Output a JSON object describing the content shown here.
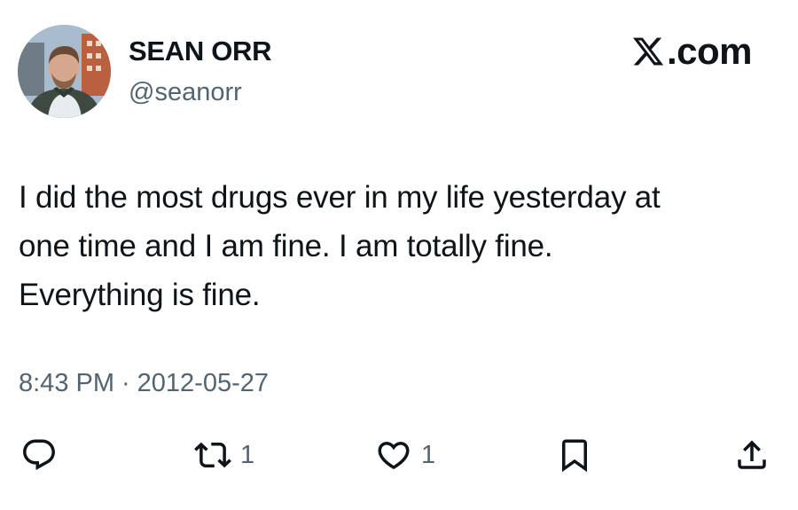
{
  "user": {
    "display_name": "SEAN ORR",
    "handle": "@seanorr"
  },
  "brand": {
    "suffix": ".com"
  },
  "tweet": {
    "lines": [
      "I did the most drugs ever in my life yesterday at",
      "one time and I am fine. I am totally fine.",
      "Everything is fine."
    ]
  },
  "meta": {
    "time": "8:43 PM",
    "separator": "·",
    "date": "2012-05-27"
  },
  "actions": {
    "reply": {
      "icon": "reply-icon"
    },
    "retweet": {
      "icon": "retweet-icon",
      "count": "1"
    },
    "like": {
      "icon": "heart-icon",
      "count": "1"
    },
    "bookmark": {
      "icon": "bookmark-icon"
    },
    "share": {
      "icon": "share-icon"
    }
  },
  "colors": {
    "text": "#0f1419",
    "secondary": "#536471",
    "background": "#ffffff"
  }
}
